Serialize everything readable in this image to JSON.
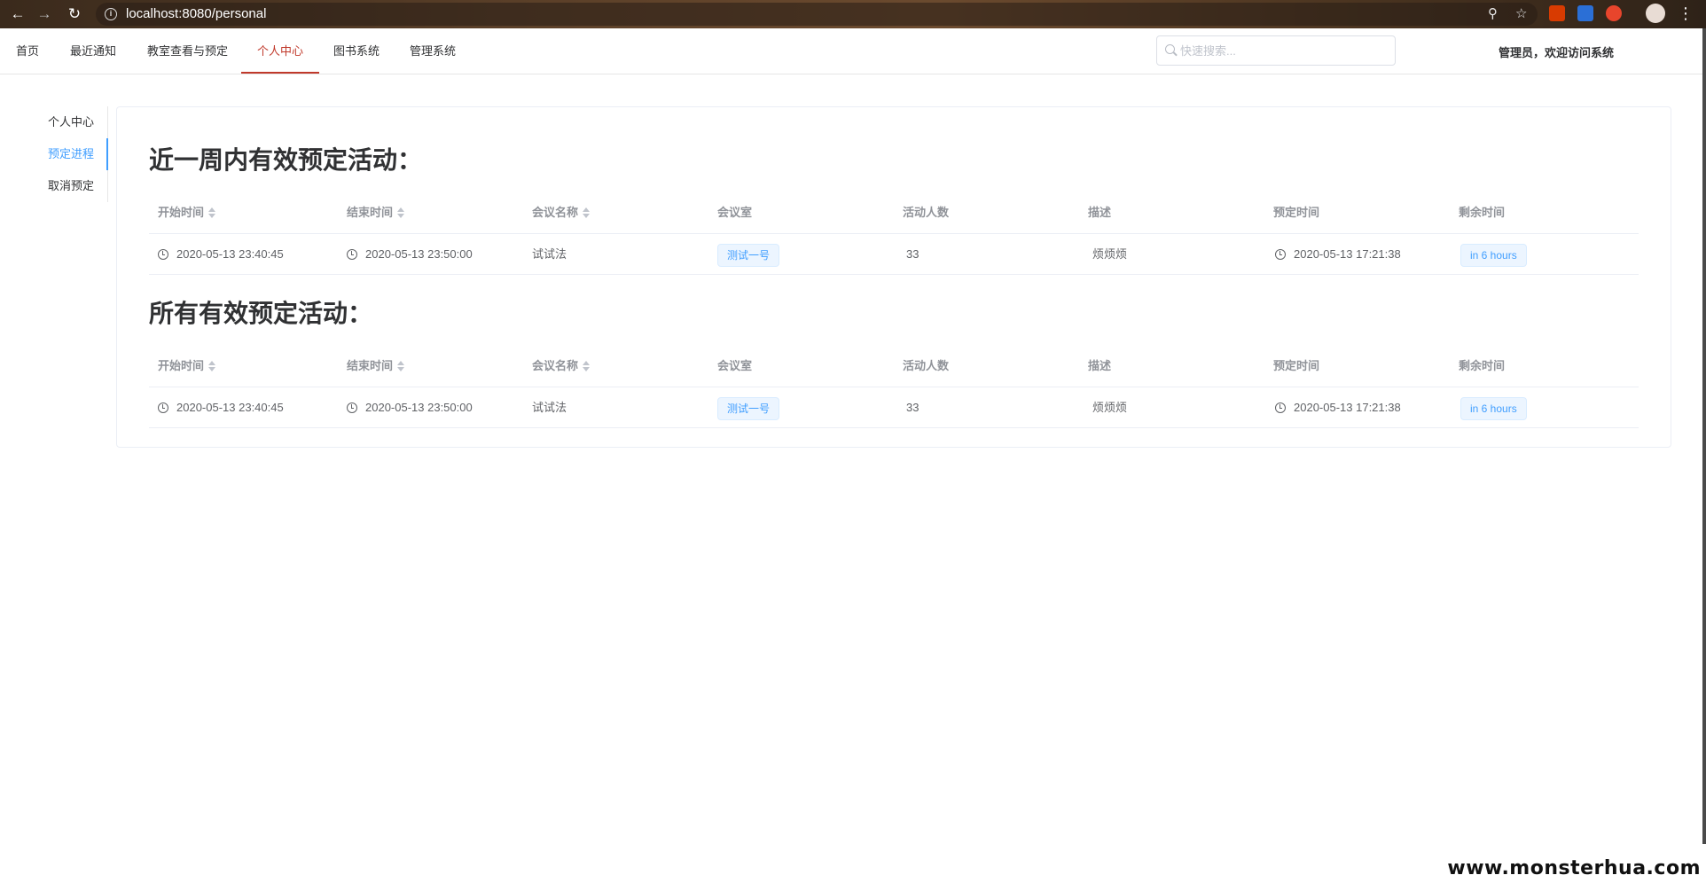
{
  "browser": {
    "url": "localhost:8080/personal",
    "back_icon": "arrow-left-icon",
    "forward_icon": "arrow-right-icon",
    "reload_icon": "reload-icon"
  },
  "topnav": {
    "items": [
      {
        "label": "首页"
      },
      {
        "label": "最近通知"
      },
      {
        "label": "教室查看与预定"
      },
      {
        "label": "个人中心",
        "active": true
      },
      {
        "label": "图书系统"
      },
      {
        "label": "管理系统"
      }
    ],
    "search_placeholder": "快速搜索...",
    "welcome": "管理员，欢迎访问系统"
  },
  "sidemenu": {
    "items": [
      {
        "label": "个人中心"
      },
      {
        "label": "预定进程",
        "active": true
      },
      {
        "label": "取消预定"
      }
    ]
  },
  "columns": [
    "开始时间",
    "结束时间",
    "会议名称",
    "会议室",
    "活动人数",
    "描述",
    "预定时间",
    "剩余时间"
  ],
  "sections": [
    {
      "title": "近一周内有效预定活动：",
      "rows": [
        {
          "start": "2020-05-13 23:40:45",
          "end": "2020-05-13 23:50:00",
          "name": "试试法",
          "room": "测试一号",
          "people": "33",
          "desc": "烦烦烦",
          "booked": "2020-05-13 17:21:38",
          "remaining": "in 6 hours"
        }
      ]
    },
    {
      "title": "所有有效预定活动：",
      "rows": [
        {
          "start": "2020-05-13 23:40:45",
          "end": "2020-05-13 23:50:00",
          "name": "试试法",
          "room": "测试一号",
          "people": "33",
          "desc": "烦烦烦",
          "booked": "2020-05-13 17:21:38",
          "remaining": "in 6 hours"
        }
      ]
    }
  ],
  "watermark": "www.monsterhua.com",
  "colors": {
    "active_nav": "#c0392b",
    "accent": "#409eff"
  }
}
